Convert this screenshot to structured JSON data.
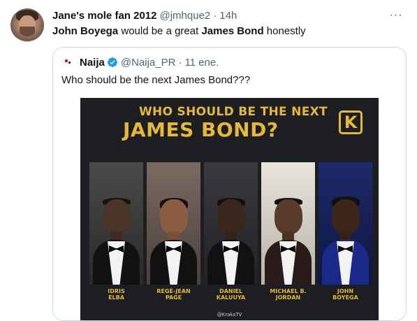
{
  "tweet": {
    "display_name": "Jane's mole fan 2012",
    "handle": "@jmhque2",
    "separator": "·",
    "time": "14h",
    "more_icon": "more-horizontal-icon",
    "text_part1": "John Boyega",
    "text_part2": " would be a great ",
    "text_part3": "James Bond",
    "text_part4": " honestly"
  },
  "quoted": {
    "display_name": "Naija",
    "verified_icon": "verified-badge-icon",
    "verified_color": "#1d9bf0",
    "handle": "@Naija_PR",
    "separator": "·",
    "time": "11 ene.",
    "text": "Who should be the next James Bond???"
  },
  "media": {
    "headline_small": "WHO SHOULD BE THE NEXT",
    "headline_large": "JAMES BOND?",
    "logo_letter": "K",
    "accent_color": "#e4b83a",
    "candidates": [
      {
        "line1": "IDRIS",
        "line2": "ELBA"
      },
      {
        "line1": "REGÉ-JEAN",
        "line2": "PAGE"
      },
      {
        "line1": "DANIEL",
        "line2": "KALUUYA"
      },
      {
        "line1": "MICHAEL B.",
        "line2": "JORDAN"
      },
      {
        "line1": "JOHN",
        "line2": "BOYEGA"
      }
    ],
    "credit": "@KraksTV"
  }
}
